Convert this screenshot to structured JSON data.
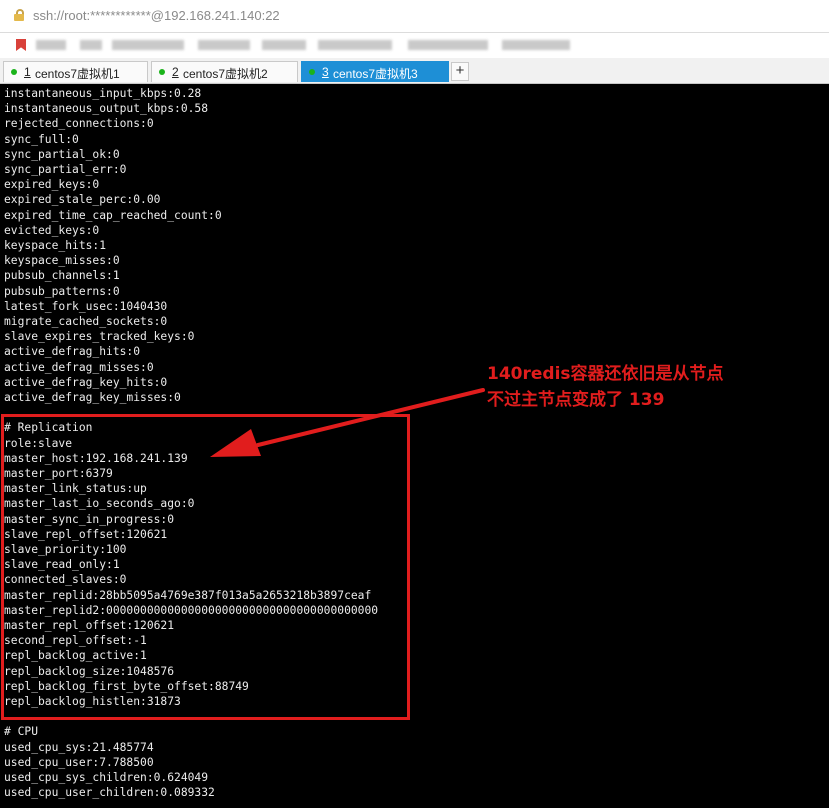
{
  "address_bar": {
    "url": "ssh://root:************@192.168.241.140:22"
  },
  "tabs": [
    {
      "number": "1",
      "title": "centos7虚拟机1",
      "active": false
    },
    {
      "number": "2",
      "title": "centos7虚拟机2",
      "active": false
    },
    {
      "number": "3",
      "title": "centos7虚拟机3",
      "active": true
    }
  ],
  "new_tab_label": "+",
  "terminal_lines": [
    "instantaneous_input_kbps:0.28",
    "instantaneous_output_kbps:0.58",
    "rejected_connections:0",
    "sync_full:0",
    "sync_partial_ok:0",
    "sync_partial_err:0",
    "expired_keys:0",
    "expired_stale_perc:0.00",
    "expired_time_cap_reached_count:0",
    "evicted_keys:0",
    "keyspace_hits:1",
    "keyspace_misses:0",
    "pubsub_channels:1",
    "pubsub_patterns:0",
    "latest_fork_usec:1040430",
    "migrate_cached_sockets:0",
    "slave_expires_tracked_keys:0",
    "active_defrag_hits:0",
    "active_defrag_misses:0",
    "active_defrag_key_hits:0",
    "active_defrag_key_misses:0",
    "",
    "# Replication",
    "role:slave",
    "master_host:192.168.241.139",
    "master_port:6379",
    "master_link_status:up",
    "master_last_io_seconds_ago:0",
    "master_sync_in_progress:0",
    "slave_repl_offset:120621",
    "slave_priority:100",
    "slave_read_only:1",
    "connected_slaves:0",
    "master_replid:28bb5095a4769e387f013a5a2653218b3897ceaf",
    "master_replid2:0000000000000000000000000000000000000000",
    "master_repl_offset:120621",
    "second_repl_offset:-1",
    "repl_backlog_active:1",
    "repl_backlog_size:1048576",
    "repl_backlog_first_byte_offset:88749",
    "repl_backlog_histlen:31873",
    "",
    "# CPU",
    "used_cpu_sys:21.485774",
    "used_cpu_user:7.788500",
    "used_cpu_sys_children:0.624049",
    "used_cpu_user_children:0.089332"
  ],
  "annotation": {
    "line1": "140redis容器还依旧是从节点",
    "line2": "不过主节点变成了 139",
    "color": "#e11d1d"
  },
  "colors": {
    "terminal_bg": "#000000",
    "terminal_fg": "#ececec",
    "active_tab": "#1e8fd6"
  }
}
